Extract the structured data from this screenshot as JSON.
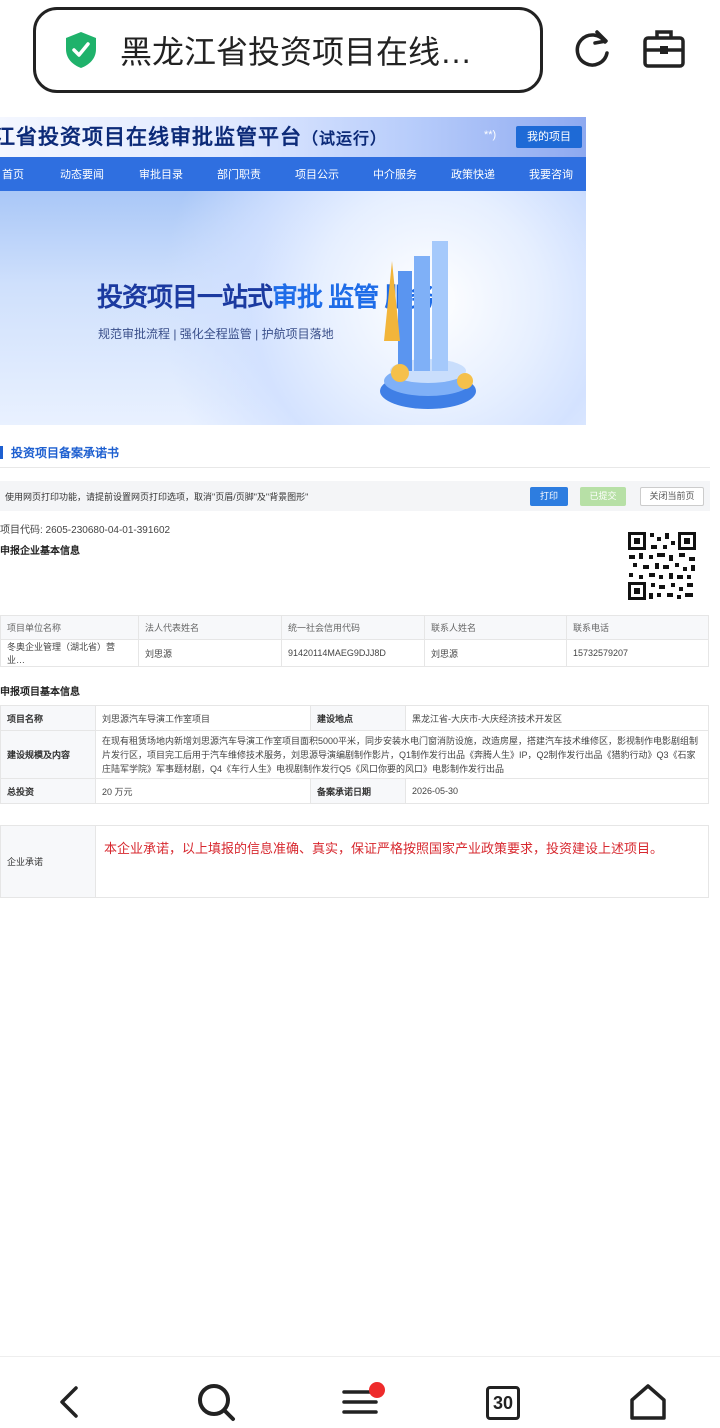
{
  "browser": {
    "url_title": "黑龙江省投资项目在线…",
    "tab_count": "30"
  },
  "site": {
    "title": "江省投资项目在线审批监管平台",
    "title_suffix": "（试运行）",
    "header_symbol": "**)",
    "my_project": "我的项目",
    "nav": [
      "首页",
      "动态要闻",
      "审批目录",
      "部门职责",
      "项目公示",
      "中介服务",
      "政策快递",
      "我要咨询"
    ],
    "banner_title_a": "投资项目一站式",
    "banner_title_b": "审批 监管 服务",
    "banner_sub": "规范审批流程 | 强化全程监管 | 护航项目落地"
  },
  "doc": {
    "section_title": "投资项目备案承诺书",
    "print_note": "使用网页打印功能，请提前设置网页打印选项，取消\"页眉/页脚\"及\"背景图形\"",
    "print_btn": "打印",
    "submitted_btn": "已提交",
    "close_btn": "关闭当前页",
    "project_code": "项目代码: 2605-230680-04-01-391602",
    "company_section": "申报企业基本信息",
    "company_headers": [
      "项目单位名称",
      "法人代表姓名",
      "统一社会信用代码",
      "联系人姓名",
      "联系电话"
    ],
    "company_values": [
      "冬奥企业管理（湖北省）营业…",
      "刘思源",
      "91420114MAEG9DJJ8D",
      "刘思源",
      "15732579207"
    ],
    "project_section": "申报项目基本信息",
    "project_name_label": "项目名称",
    "project_name": "刘思源汽车导演工作室项目",
    "location_label": "建设地点",
    "location": "黑龙江省-大庆市-大庆经济技术开发区",
    "scale_label": "建设规模及内容",
    "scale_text": "在现有租赁场地内新增刘思源汽车导演工作室项目面积5000平米，同步安装水电门窗消防设施，改造房屋，搭建汽车技术维修区，影视制作电影剧组制片发行区，项目完工后用于汽车维修技术服务，刘思源导演编剧制作影片，Q1制作发行出品《奔腾人生》IP，Q2制作发行出品《猎豹行动》Q3《石家庄陆军学院》军事题材剧，Q4《车行人生》电视剧制作发行Q5《风口你要的风口》电影制作发行出品",
    "investment_label": "总投资",
    "investment": "20 万元",
    "date_label": "备案承诺日期",
    "date": "2026-05-30",
    "pledge_label": "企业承诺",
    "pledge_text": "本企业承诺，以上填报的信息准确、真实，保证严格按照国家产业政策要求，投资建设上述项目。"
  },
  "colors": {
    "nav_blue": "#2f6fe0",
    "pledge_red": "#d7282f",
    "badge_red": "#ee2b2b",
    "shield_green": "#1fb26b"
  }
}
